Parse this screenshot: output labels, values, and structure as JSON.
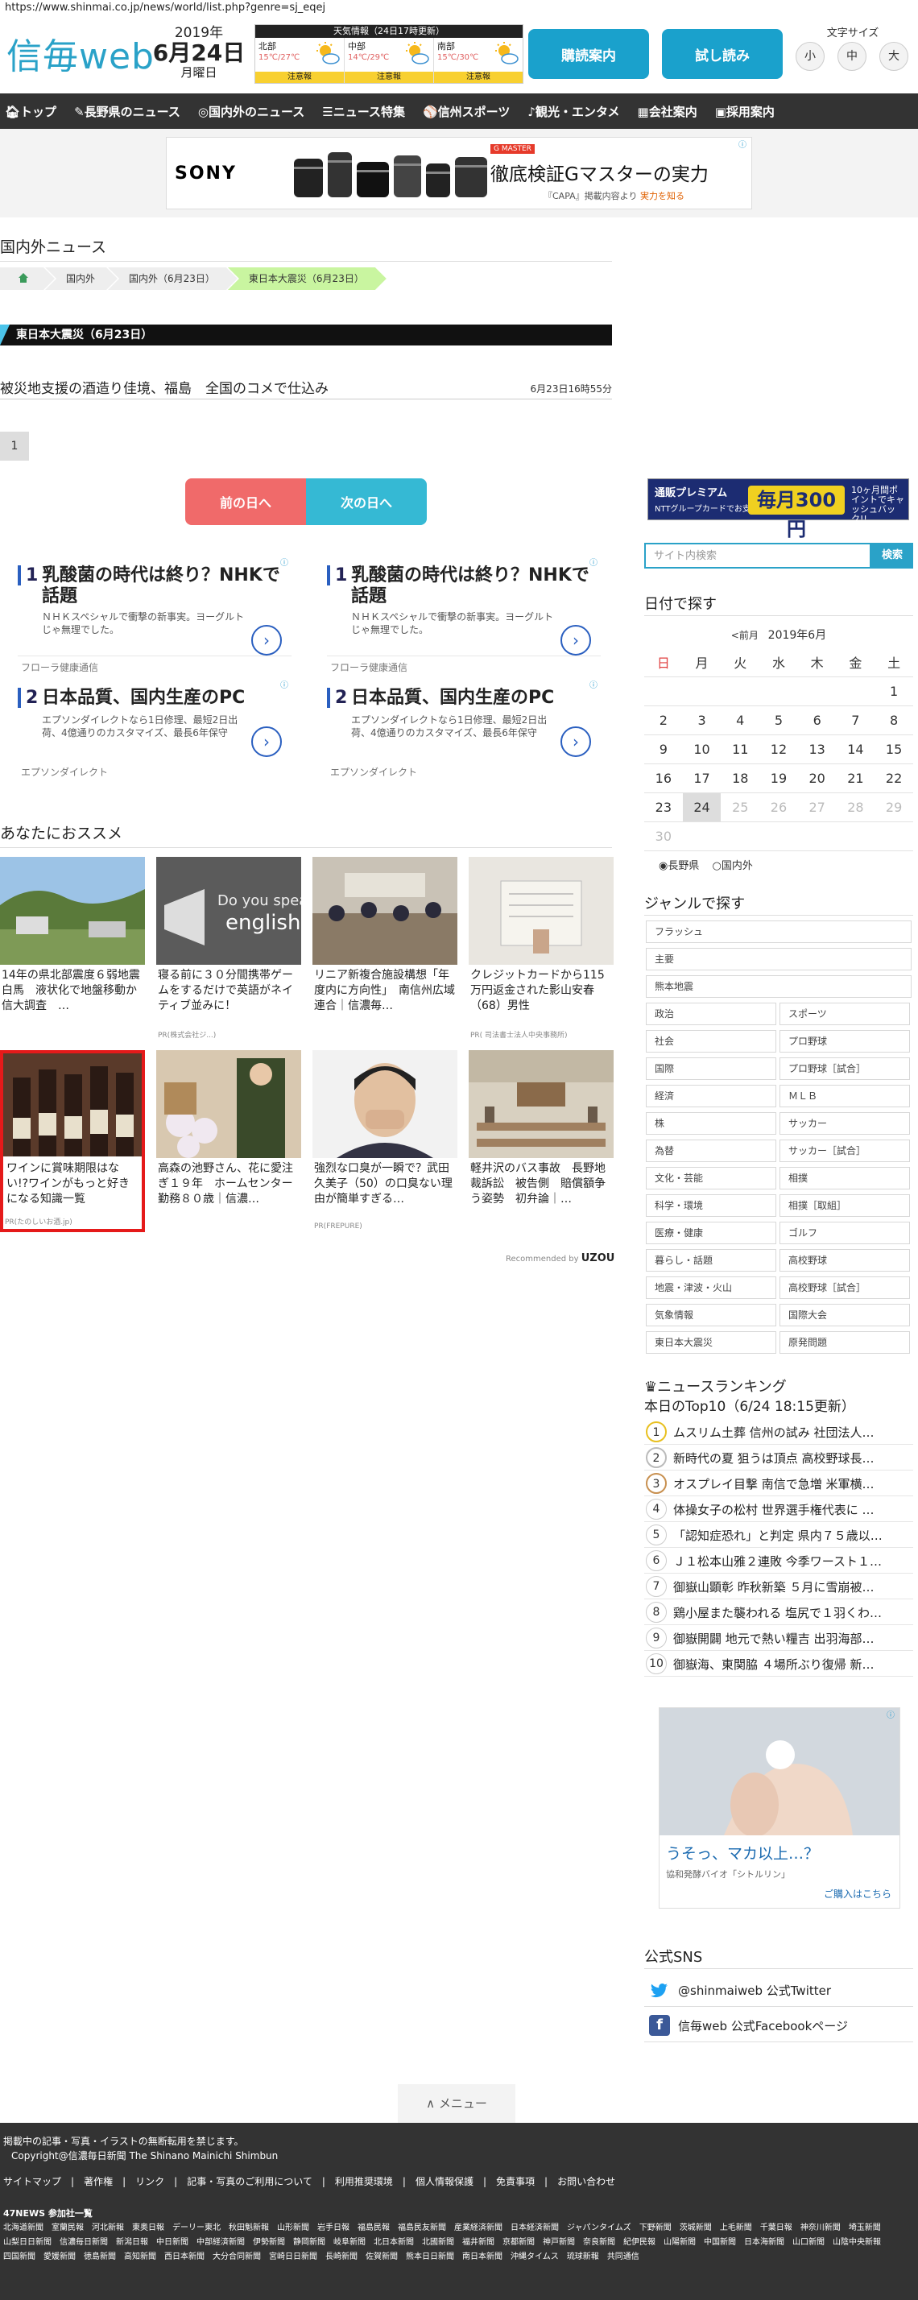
{
  "browser": {
    "url": "https://www.shinmai.co.jp/news/world/list.php?genre=sj_eqej"
  },
  "header": {
    "logo": "信毎web",
    "date": {
      "year": "2019年",
      "monthday": "6月24日",
      "weekday": "月曜日"
    },
    "weather": {
      "title": "天気情報（24日17時更新）",
      "regions": [
        {
          "name": "北部",
          "temp": "15℃/27℃",
          "warning": "注意報"
        },
        {
          "name": "中部",
          "temp": "14℃/29℃",
          "warning": "注意報"
        },
        {
          "name": "南部",
          "temp": "15℃/30℃",
          "warning": "注意報"
        }
      ]
    },
    "subscribe": "購読案内",
    "trial": "試し読み",
    "font_size": {
      "label": "文字サイズ",
      "small": "小",
      "medium": "中",
      "large": "大"
    }
  },
  "nav": [
    "トップ",
    "長野県のニュース",
    "国内外のニュース",
    "ニュース特集",
    "信州スポーツ",
    "観光・エンタメ",
    "会社案内",
    "採用案内"
  ],
  "ad_top": {
    "brand": "SONY",
    "tag": "G MASTER",
    "headline": "徹底検証Gマスターの実力",
    "sub": "『CAPA』掲載内容より",
    "sub_link": "実力を知る"
  },
  "section": {
    "title": "国内外ニュース"
  },
  "breadcrumb": [
    "国内外",
    "国内外（6月23日）",
    "東日本大震災（6月23日）"
  ],
  "category_bar": "東日本大震災（6月23日）",
  "articles": [
    {
      "title": "被災地支援の酒造り佳境、福島　全国のコメで仕込み",
      "time": "6月23日16時55分"
    }
  ],
  "pagination": {
    "current": "1"
  },
  "day_nav": {
    "prev": "前の日へ",
    "next": "次の日へ"
  },
  "native_ads": [
    {
      "num": "1",
      "title": "乳酸菌の時代は終り？NHKで話題",
      "desc": "ＮＨＫスペシャルで衝撃の新事実。ヨーグルトじゃ無理でした。",
      "source": "フローラ健康通信"
    },
    {
      "num": "1",
      "title": "乳酸菌の時代は終り？NHKで話題",
      "desc": "ＮＨＫスペシャルで衝撃の新事実。ヨーグルトじゃ無理でした。",
      "source": "フローラ健康通信"
    },
    {
      "num": "2",
      "title": "日本品質、国内生産のPC",
      "desc": "エプソンダイレクトなら1日修理、最短2日出荷、4億通りのカスタマイズ、最長6年保守",
      "source": "エプソンダイレクト"
    },
    {
      "num": "2",
      "title": "日本品質、国内生産のPC",
      "desc": "エプソンダイレクトなら1日修理、最短2日出荷、4億通りのカスタマイズ、最長6年保守",
      "source": "エプソンダイレクト"
    }
  ],
  "recommend": {
    "title": "あなたにおススメ",
    "cards": [
      {
        "title": "14年の県北部震度６弱地震　白馬　液状化で地盤移動か　信大調査　…",
        "pr": ""
      },
      {
        "title": "寝る前に３０分間携帯ゲームをするだけで英語がネイティブ並みに！",
        "pr": "PR(株式会社ジ...)"
      },
      {
        "title": "リニア新複合施設構想「年度内に方向性」　南信州広域連合｜信濃毎…",
        "pr": ""
      },
      {
        "title": "クレジットカードから115万円返金された影山安春（68）男性",
        "pr": "PR( 司法書士法人中央事務所)"
      },
      {
        "title": "ワインに賞味期限はない!?ワインがもっと好きになる知識一覧",
        "pr": "PR(たのしいお酒.jp)"
      },
      {
        "title": "高森の池野さん、花に愛注ぎ１９年　ホームセンター勤務８０歳｜信濃…",
        "pr": ""
      },
      {
        "title": "強烈な口臭が一瞬で？武田久美子（50）の口臭ない理由が簡単すぎる…",
        "pr": "PR(FREPURE)"
      },
      {
        "title": "軽井沢のバス事故　長野地裁訴訟　被告側　賠償額争う姿勢　初弁論｜…",
        "pr": ""
      }
    ],
    "recommended_by": "Recommended by",
    "uzou": "UZOU"
  },
  "sidebar": {
    "banner": {
      "a": "通販プレミアム",
      "b": "NTTグループカードでお支払いすると",
      "c": "毎月300円",
      "d": "10ヶ月間ポイントでキャッシュバック!!"
    },
    "search": {
      "placeholder": "サイト内検索",
      "button": "検索"
    },
    "calendar": {
      "title": "日付で探す",
      "prev": "<前月",
      "month": "2019年6月",
      "weekdays": [
        "日",
        "月",
        "火",
        "水",
        "木",
        "金",
        "土"
      ],
      "weeks": [
        [
          "",
          "",
          "",
          "",
          "",
          "",
          "1"
        ],
        [
          "2",
          "3",
          "4",
          "5",
          "6",
          "7",
          "8"
        ],
        [
          "9",
          "10",
          "11",
          "12",
          "13",
          "14",
          "15"
        ],
        [
          "16",
          "17",
          "18",
          "19",
          "20",
          "21",
          "22"
        ],
        [
          "23",
          "24",
          "25",
          "26",
          "27",
          "28",
          "29"
        ],
        [
          "30",
          "",
          "",
          "",
          "",
          "",
          ""
        ]
      ],
      "today": "24",
      "radio": [
        "長野県",
        "国内外"
      ]
    },
    "genre": {
      "title": "ジャンルで探す",
      "full": [
        "フラッシュ",
        "主要",
        "熊本地震"
      ],
      "pairs": [
        [
          "政治",
          "スポーツ"
        ],
        [
          "社会",
          "プロ野球"
        ],
        [
          "国際",
          "プロ野球［試合］"
        ],
        [
          "経済",
          "ＭＬＢ"
        ],
        [
          "株",
          "サッカー"
        ],
        [
          "為替",
          "サッカー［試合］"
        ],
        [
          "文化・芸能",
          "相撲"
        ],
        [
          "科学・環境",
          "相撲［取組］"
        ],
        [
          "医療・健康",
          "ゴルフ"
        ],
        [
          "暮らし・話題",
          "高校野球"
        ],
        [
          "地震・津波・火山",
          "高校野球［試合］"
        ],
        [
          "気象情報",
          "国際大会"
        ],
        [
          "東日本大震災",
          "原発問題"
        ]
      ]
    },
    "ranking": {
      "title": "ニュースランキング",
      "subtitle": "本日のTop10（6/24 18:15更新）",
      "items": [
        "ムスリム土葬 信州の試み 社団法人…",
        "新時代の夏 狙うは頂点 高校野球長…",
        "オスプレイ目撃 南信で急増 米軍横…",
        "体操女子の松村 世界選手権代表に …",
        "「認知症恐れ」と判定 県内７５歳以…",
        "Ｊ１松本山雅２連敗 今季ワースト１…",
        "御嶽山顕彰 昨秋新築 ５月に雪崩被…",
        "鶏小屋また襲われる 塩尻で１羽くわ…",
        "御嶽開闢 地元で熱い糧吉 出羽海部…",
        "御嶽海、東関脇 ４場所ぶり復帰 新…"
      ]
    },
    "ad": {
      "headline": "うそっ、マカ以上…？",
      "company": "協和発酵バイオ「シトルリン」",
      "link": "ご購入はこちら"
    },
    "sns": {
      "title": "公式SNS",
      "twitter": "@shinmaiweb 公式Twitter",
      "facebook": "信毎web 公式Facebookページ"
    }
  },
  "menu": "メニュー",
  "footer": {
    "notice": "掲載中の記事・写真・イラストの無断転用を禁じます。",
    "copyright": "Copyright@信濃毎日新聞 The Shinano Mainichi Shimbun",
    "links": [
      "サイトマップ",
      "著作権",
      "リンク",
      "記事・写真のご利用について",
      "利用推奨環境",
      "個人情報保護",
      "免責事項",
      "お問い合わせ"
    ],
    "papers_title": "47NEWS 参加社一覧",
    "papers": [
      "北海道新聞",
      "室蘭民報",
      "河北新報",
      "東奥日報",
      "デーリー東北",
      "秋田魁新報",
      "山形新聞",
      "岩手日報",
      "福島民報",
      "福島民友新聞",
      "産業経済新聞",
      "日本経済新聞",
      "ジャパンタイムズ",
      "下野新聞",
      "茨城新聞",
      "上毛新聞",
      "千葉日報",
      "神奈川新聞",
      "埼玉新聞",
      "山梨日日新聞",
      "信濃毎日新聞",
      "新潟日報",
      "中日新聞",
      "中部経済新聞",
      "伊勢新聞",
      "静岡新聞",
      "岐阜新聞",
      "北日本新聞",
      "北國新聞",
      "福井新聞",
      "京都新聞",
      "神戸新聞",
      "奈良新聞",
      "紀伊民報",
      "山陽新聞",
      "中国新聞",
      "日本海新聞",
      "山口新聞",
      "山陰中央新報",
      "四国新聞",
      "愛媛新聞",
      "徳島新聞",
      "高知新聞",
      "西日本新聞",
      "大分合同新聞",
      "宮崎日日新聞",
      "長崎新聞",
      "佐賀新聞",
      "熊本日日新聞",
      "南日本新聞",
      "沖縄タイムス",
      "琉球新報",
      "共同通信"
    ]
  }
}
